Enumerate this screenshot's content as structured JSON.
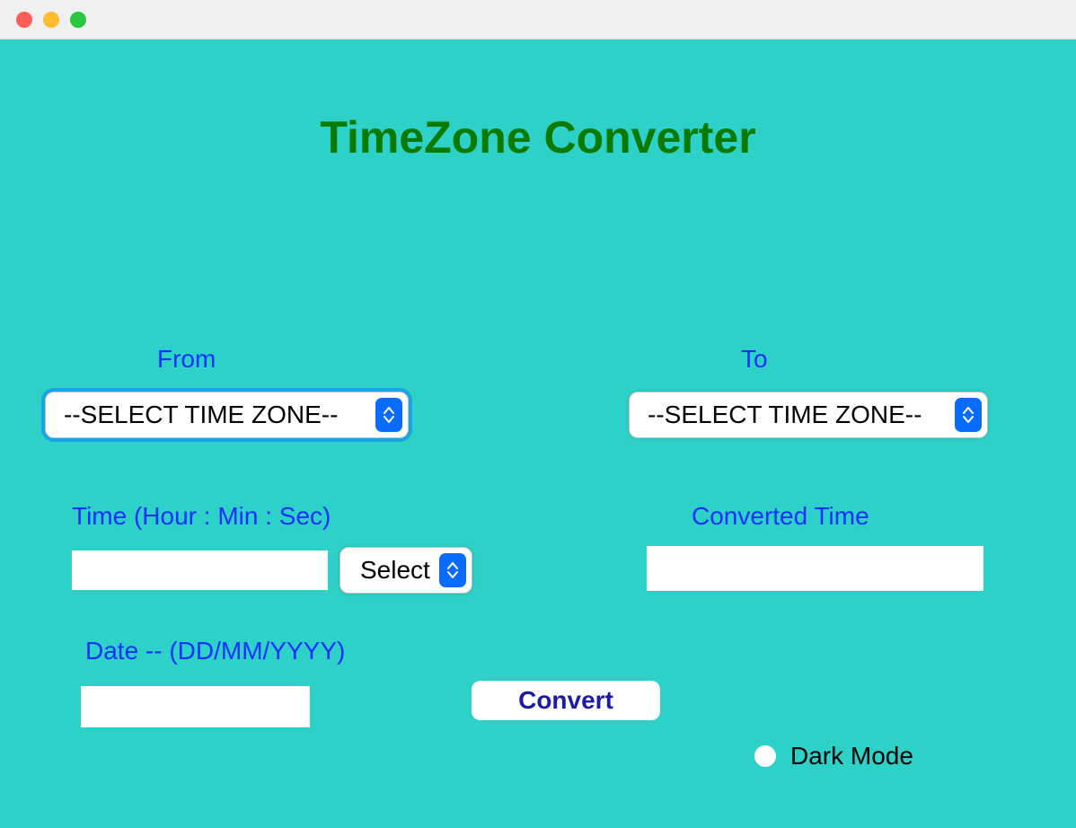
{
  "window": {
    "close_icon": "close",
    "minimize_icon": "minimize",
    "maximize_icon": "maximize"
  },
  "app": {
    "title": "TimeZone Converter"
  },
  "labels": {
    "from": "From",
    "to": "To",
    "time": "Time (Hour : Min : Sec)",
    "converted_time": "Converted Time",
    "date": "Date -- (DD/MM/YYYY)",
    "dark_mode": "Dark Mode"
  },
  "selects": {
    "from_zone": "--SELECT TIME ZONE--",
    "to_zone": "--SELECT TIME ZONE--",
    "ampm": "Select"
  },
  "inputs": {
    "time_value": "",
    "date_value": "",
    "converted_value": ""
  },
  "buttons": {
    "convert": "Convert"
  },
  "states": {
    "dark_mode_on": false
  },
  "colors": {
    "background": "#2ed1c8",
    "title": "#0a7a00",
    "label": "#1730ff",
    "button_text": "#1e1aa8",
    "select_chevron": "#0a6cff"
  }
}
